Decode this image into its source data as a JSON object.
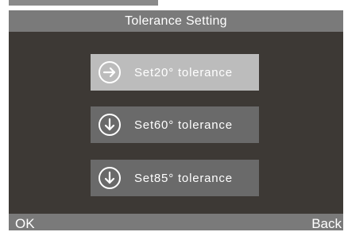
{
  "screen": {
    "title": "Tolerance Setting"
  },
  "menu": {
    "items": [
      {
        "label": "Set20° tolerance",
        "icon": "arrow-right-circle-icon",
        "selected": true
      },
      {
        "label": "Set60° tolerance",
        "icon": "arrow-down-circle-icon",
        "selected": false
      },
      {
        "label": "Set85° tolerance",
        "icon": "arrow-down-circle-icon",
        "selected": false
      }
    ]
  },
  "softkeys": {
    "left": "OK",
    "right": "Back"
  },
  "colors": {
    "screen_background": "#3d3935",
    "bar_background": "#7a7a7a",
    "button_background": "#6a6a6a",
    "selected_button_background": "#bcbcbc",
    "text": "#ffffff"
  }
}
